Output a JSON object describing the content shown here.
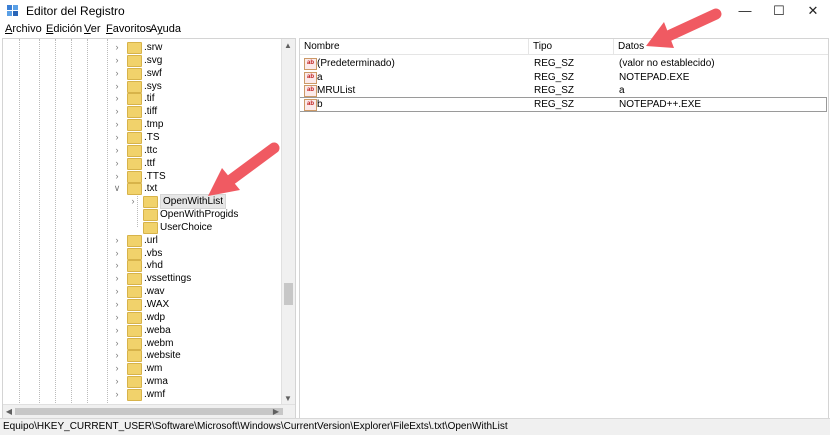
{
  "window": {
    "title": "Editor del Registro",
    "controls": [
      "—",
      "☐",
      "✕"
    ]
  },
  "menu": [
    {
      "label": "Archivo",
      "accel": "A",
      "rest": "rchivo"
    },
    {
      "label": "Edición",
      "accel": "E",
      "rest": "dición"
    },
    {
      "label": "Ver",
      "accel": "V",
      "rest": "er"
    },
    {
      "label": "Favoritos",
      "accel": "F",
      "rest": "avoritos"
    },
    {
      "label": "Ayuda",
      "accel": "y",
      "pre": "A",
      "rest": "uda"
    }
  ],
  "tree": {
    "items_above": [
      ".srw",
      ".svg",
      ".swf",
      ".sys",
      ".tif",
      ".tiff",
      ".tmp",
      ".TS",
      ".ttc",
      ".ttf",
      ".TTS"
    ],
    "expanded": ".txt",
    "children": [
      "OpenWithList",
      "OpenWithProgids",
      "UserChoice"
    ],
    "selected_child": "OpenWithList",
    "items_below": [
      ".url",
      ".vbs",
      ".vhd",
      ".vssettings",
      ".wav",
      ".WAX",
      ".wdp",
      ".weba",
      ".webm",
      ".website",
      ".wm",
      ".wma",
      ".wmf"
    ]
  },
  "list": {
    "columns": [
      "Nombre",
      "Tipo",
      "Datos"
    ],
    "rows": [
      {
        "name": "(Predeterminado)",
        "type": "REG_SZ",
        "data": "(valor no establecido)"
      },
      {
        "name": "a",
        "type": "REG_SZ",
        "data": "NOTEPAD.EXE"
      },
      {
        "name": "MRUList",
        "type": "REG_SZ",
        "data": "a"
      },
      {
        "name": "b",
        "type": "REG_SZ",
        "data": "NOTEPAD++.EXE"
      }
    ],
    "selected_row": 3
  },
  "status": {
    "path": "Equipo\\HKEY_CURRENT_USER\\Software\\Microsoft\\Windows\\CurrentVersion\\Explorer\\FileExts\\.txt\\OpenWithList"
  },
  "colors": {
    "annotation_arrow": "#f05a62",
    "folder": "#f1d26b"
  }
}
